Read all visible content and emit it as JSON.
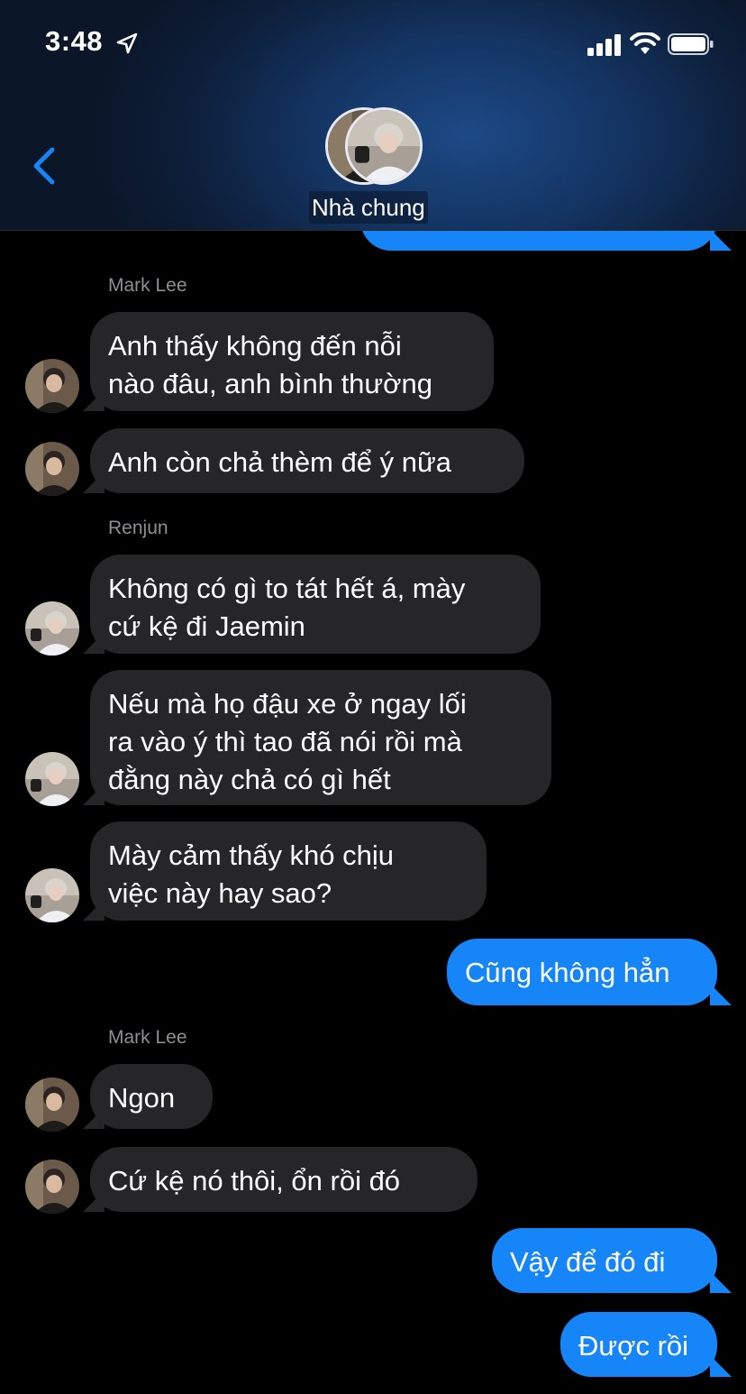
{
  "status_bar": {
    "time": "3:48",
    "icons": [
      "location-arrow-icon",
      "signal-icon",
      "wifi-icon",
      "battery-icon"
    ]
  },
  "header": {
    "group_name": "Nhà chung",
    "back_icon": "chevron-left-icon"
  },
  "colors": {
    "accent": "#1685f8",
    "incoming_bubble": "#262628",
    "background": "#000000",
    "sender_label": "#8e8e93"
  },
  "chat": {
    "sender_mark_1": "Mark Lee",
    "sender_renjun": "Renjun",
    "sender_mark_2": "Mark Lee",
    "messages": [
      {
        "from": "Mark Lee",
        "text": "Anh thấy không đến nỗi\nnào đâu, anh bình thường"
      },
      {
        "from": "Mark Lee",
        "text": "Anh còn chả thèm để ý nữa"
      },
      {
        "from": "Renjun",
        "text": "Không có gì to tát hết á, mày\ncứ kệ đi Jaemin"
      },
      {
        "from": "Renjun",
        "text": "Nếu mà họ đậu xe ở ngay lối\nra vào ý thì tao đã nói rồi mà\nđằng này chả có gì hết"
      },
      {
        "from": "Renjun",
        "text": "Mày cảm thấy khó chịu\nviệc này hay sao?"
      },
      {
        "from": "me",
        "text": "Cũng không hẳn"
      },
      {
        "from": "Mark Lee",
        "text": "Ngon"
      },
      {
        "from": "Mark Lee",
        "text": "Cứ kệ nó thôi, ổn rồi đó"
      },
      {
        "from": "me",
        "text": "Vậy để đó đi"
      },
      {
        "from": "me",
        "text": "Được rồi"
      }
    ]
  }
}
